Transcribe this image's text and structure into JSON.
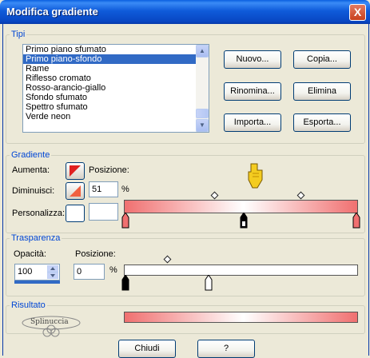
{
  "window": {
    "title": "Modifica gradiente",
    "close_glyph": "X"
  },
  "tipi": {
    "legend": "Tipi",
    "list_items": [
      "Primo piano sfumato",
      "Primo piano-sfondo",
      "Rame",
      "Riflesso cromato",
      "Rosso-arancio-giallo",
      "Sfondo sfumato",
      "Spettro sfumato",
      "Verde neon"
    ],
    "selected_index": 1,
    "buttons": {
      "nuovo": "Nuovo...",
      "copia": "Copia...",
      "rinomina": "Rinomina...",
      "elimina": "Elimina",
      "importa": "Importa...",
      "esporta": "Esporta..."
    }
  },
  "gradiente": {
    "legend": "Gradiente",
    "aumenta_label": "Aumenta:",
    "posizione_label": "Posizione:",
    "diminuisci_label": "Diminuisci:",
    "diminuisci_value": "51",
    "percent": "%",
    "personalizza_label": "Personalizza:",
    "colors": {
      "start": "#F07070",
      "end": "#F07070",
      "mid": "#FFFFFF"
    }
  },
  "trasparenza": {
    "legend": "Trasparenza",
    "opacita_label": "Opacità:",
    "opacita_value": "100",
    "posizione_label": "Posizione:",
    "posizione_value": "0",
    "percent": "%"
  },
  "risultato": {
    "legend": "Risultato",
    "logo_text": "Splinuccia"
  },
  "footer": {
    "chiudi": "Chiudi",
    "help": "?"
  }
}
